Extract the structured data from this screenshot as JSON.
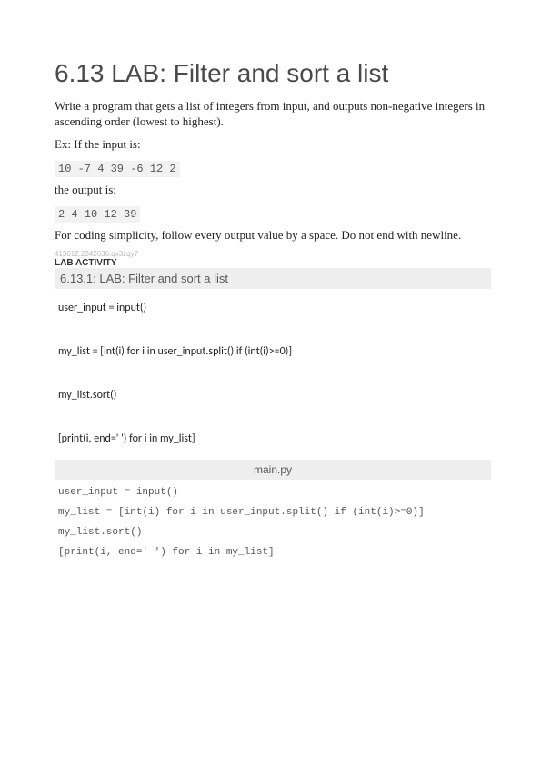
{
  "title": "6.13 LAB: Filter and sort a list",
  "description": "Write a program that gets a list of integers from input, and outputs non-negative integers in ascending order (lowest to highest).",
  "example_prefix": "Ex: If the input is:",
  "example_input": "10 -7 4 39 -6 12 2",
  "output_label": "the output is:",
  "example_output": "2 4 10 12 39",
  "note": "For coding simplicity, follow every output value by a space. Do not end with newline.",
  "small_id": "413612.2342636.qx3zqy7",
  "lab_label": "LAB ACTIVITY",
  "lab_bar": "6.13.1: LAB: Filter and sort a list",
  "student_lines": {
    "l1": "user_input = input()",
    "l2": "my_list = [int(i) for i in user_input.split() if (int(i)>=0)]",
    "l3": "my_list.sort()",
    "l4": "[print(i, end=' ') for i in my_list]"
  },
  "file_tab": "main.py",
  "source_lines": {
    "s1": "user_input = input()",
    "s2": "my_list = [int(i) for i in user_input.split() if (int(i)>=0)]",
    "s3": "my_list.sort()",
    "s4": "[print(i, end=' ') for i in my_list]"
  }
}
